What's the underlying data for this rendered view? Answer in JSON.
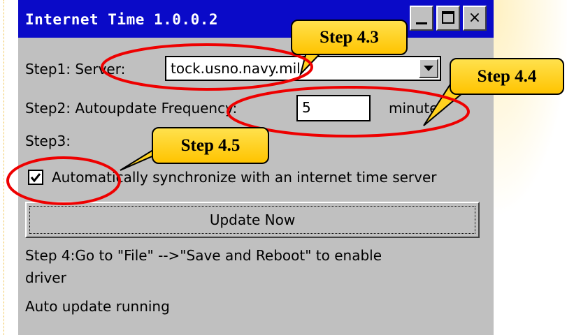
{
  "window": {
    "title": "Internet Time 1.0.0.2",
    "controls": [
      "minimize",
      "maximize",
      "close"
    ],
    "close_glyph": "×"
  },
  "step1": {
    "label": "Step1: Server:",
    "server_value": "tock.usno.navy.mil"
  },
  "step2": {
    "label": "Step2: Autoupdate Frequency:",
    "frequency_value": "5",
    "unit": "minute"
  },
  "step3": {
    "label": "Step3:",
    "checkbox_label": "Automatically synchronize with an internet time server",
    "checked": true
  },
  "update_button": {
    "label": "Update Now"
  },
  "step4": {
    "line1": "Step 4:Go to \"File\" -->\"Save and Reboot\" to enable",
    "line2": "driver"
  },
  "status": {
    "text": "Auto update running"
  },
  "callouts": [
    {
      "label": "Step 4.3"
    },
    {
      "label": "Step 4.4"
    },
    {
      "label": "Step 4.5"
    }
  ],
  "colors": {
    "titlebar": "#0a0ac8",
    "window_bg": "#c0c0c0",
    "callout_fill": "#ffd21f",
    "ring": "#ee0000"
  }
}
